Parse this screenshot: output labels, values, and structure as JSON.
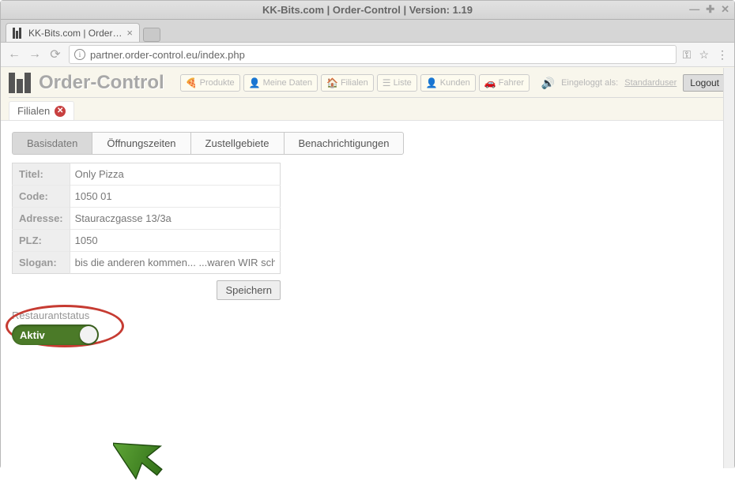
{
  "os": {
    "title": "KK-Bits.com | Order-Control | Version: 1.19"
  },
  "browser": {
    "tab_title": "KK-Bits.com | Order…",
    "url": "partner.order-control.eu/index.php"
  },
  "app": {
    "title": "Order-Control",
    "nav": {
      "produkte": "Produkte",
      "meine_daten": "Meine Daten",
      "filialen": "Filialen",
      "liste": "Liste",
      "kunden": "Kunden",
      "fahrer": "Fahrer"
    },
    "login": {
      "prefix": "Eingeloggt als:",
      "user": "Standarduser",
      "logout": "Logout"
    },
    "breadcrumb": "Filialen"
  },
  "tabs": {
    "basisdaten": "Basisdaten",
    "oeffnungszeiten": "Öffnungszeiten",
    "zustellgebiete": "Zustellgebiete",
    "benachrichtigungen": "Benachrichtigungen"
  },
  "form": {
    "labels": {
      "titel": "Titel:",
      "code": "Code:",
      "adresse": "Adresse:",
      "plz": "PLZ:",
      "slogan": "Slogan:"
    },
    "values": {
      "titel": "Only Pizza",
      "code": "1050 01",
      "adresse": "Stauraczgasse 13/3a",
      "plz": "1050",
      "slogan": "bis die anderen kommen... ...waren WIR scho"
    },
    "save": "Speichern"
  },
  "status": {
    "heading": "Restaurantstatus",
    "active_label": "Aktiv"
  }
}
